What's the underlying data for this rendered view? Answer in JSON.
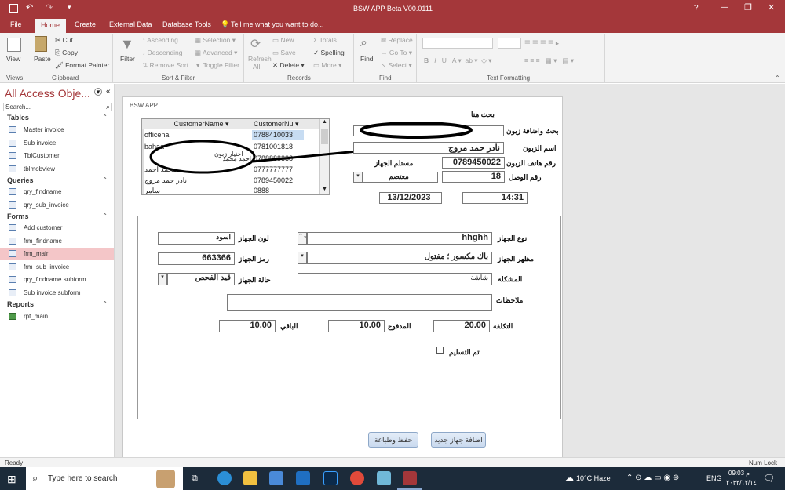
{
  "titlebar": {
    "title": "BSW APP  Beta V00.0111",
    "help": "?"
  },
  "tabs": [
    "File",
    "Home",
    "Create",
    "External Data",
    "Database Tools"
  ],
  "tellme": "Tell me what you want to do...",
  "ribbon": {
    "view": "View",
    "paste": "Paste",
    "cut": "Cut",
    "copy": "Copy",
    "format_painter": "Format Painter",
    "filter": "Filter",
    "ascending": "Ascending",
    "descending": "Descending",
    "remove_sort": "Remove Sort",
    "selection": "Selection",
    "advanced": "Advanced",
    "toggle_filter": "Toggle Filter",
    "refresh": "Refresh",
    "refresh_all": "All",
    "new": "New",
    "save": "Save",
    "delete": "Delete",
    "totals": "Totals",
    "spelling": "Spelling",
    "more": "More",
    "find": "Find",
    "replace": "Replace",
    "goto": "Go To",
    "select": "Select",
    "groups": [
      "Views",
      "Clipboard",
      "Sort & Filter",
      "Records",
      "Find",
      "Text Formatting"
    ]
  },
  "nav": {
    "title": "All Access Obje...",
    "search_placeholder": "Search...",
    "sections": [
      {
        "name": "Tables",
        "items": [
          "Master invoice",
          "Sub invoice",
          "TblCustomer",
          "tblmobview"
        ]
      },
      {
        "name": "Queries",
        "items": [
          "qry_findname",
          "qry_sub_invoice"
        ]
      },
      {
        "name": "Forms",
        "items": [
          "Add customer",
          "frm_findname",
          "frm_main",
          "frm_sub_invoice",
          "qry_findname subform",
          "Sub invoice subform"
        ]
      },
      {
        "name": "Reports",
        "items": [
          "rpt_main"
        ]
      }
    ]
  },
  "form": {
    "caption": "BSW APP",
    "search_here": "بحث هنا",
    "grid": {
      "headers": [
        "CustomerName",
        "CustomerNu"
      ],
      "rows": [
        [
          "officena",
          "0788410033"
        ],
        [
          "bahaa",
          "0781001818"
        ],
        [
          "احمد محمد",
          "0788888888"
        ],
        [
          "محمد احمد",
          "0777777777"
        ],
        [
          "نادر حمد مروج",
          "0789450022"
        ],
        [
          "سامر",
          "0888"
        ]
      ],
      "overlay_label": "اختيار زبون"
    },
    "labels": {
      "search_add": "بحث واضافة زبون",
      "customer_name": "اسم الزبون",
      "customer_phone": "رقم هاتف الزبون",
      "receiver": "مستلم الجهاز",
      "receipt_no": "رقم الوصل",
      "device_type": "نوع الجهاز",
      "device_color": "لون الجهاز",
      "device_appearance": "مظهر الجهاز",
      "device_code": "رمز الجهاز",
      "problem": "المشكلة",
      "device_status": "حالة الجهاز",
      "notes": "ملاحظات",
      "cost": "التكلفة",
      "paid": "المدفوع",
      "remaining": "الباقي",
      "delivered": "تم التسليم"
    },
    "values": {
      "customer_name": "نادر حمد مروج",
      "customer_phone": "0789450022",
      "receiver": "معتصم",
      "receipt_no": "18",
      "date": "13/12/2023",
      "time": "14:31",
      "device_type": "hhghh",
      "device_color": "اسود",
      "device_appearance": "باك مكسور ؛ مفتول",
      "device_code": "663366",
      "problem": "شاشة",
      "device_status": "قيد الفحص",
      "notes": "",
      "cost": "20.00",
      "paid": "10.00",
      "remaining": "10.00"
    },
    "buttons": {
      "save_print": "حفظ وطباعة",
      "add_device": "اضافة جهاز جديد"
    }
  },
  "status": {
    "left": "Ready",
    "right": "Num Lock"
  },
  "taskbar": {
    "search": "Type here to search",
    "weather": "10°C  Haze",
    "lang": "ENG",
    "time": "09:03 م",
    "date": "٢٠٢٣/١٢/١٤"
  }
}
